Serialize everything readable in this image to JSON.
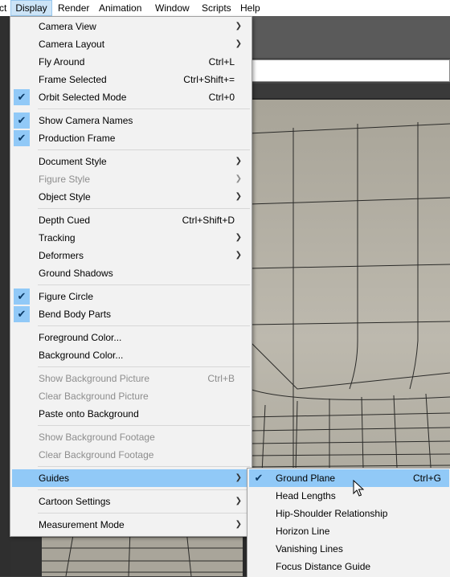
{
  "menubar": {
    "items": [
      "ct",
      "Display",
      "Render",
      "Animation",
      "Window",
      "Scripts",
      "Help"
    ],
    "open_item": "Display"
  },
  "display_menu": {
    "items": [
      {
        "label": "Camera View",
        "submenu": true
      },
      {
        "label": "Camera Layout",
        "submenu": true
      },
      {
        "label": "Fly Around",
        "shortcut": "Ctrl+L"
      },
      {
        "label": "Frame Selected",
        "shortcut": "Ctrl+Shift+="
      },
      {
        "label": "Orbit Selected Mode",
        "shortcut": "Ctrl+0",
        "checked": true
      },
      {
        "label": "Show Camera Names",
        "checked": true
      },
      {
        "label": "Production Frame",
        "checked": true
      },
      {
        "label": "Document Style",
        "submenu": true
      },
      {
        "label": "Figure Style",
        "submenu": true,
        "disabled": true
      },
      {
        "label": "Object Style",
        "submenu": true
      },
      {
        "label": "Depth Cued",
        "shortcut": "Ctrl+Shift+D"
      },
      {
        "label": "Tracking",
        "submenu": true
      },
      {
        "label": "Deformers",
        "submenu": true
      },
      {
        "label": "Ground Shadows"
      },
      {
        "label": "Figure Circle",
        "checked": true
      },
      {
        "label": "Bend Body Parts",
        "checked": true
      },
      {
        "label": "Foreground Color..."
      },
      {
        "label": "Background Color..."
      },
      {
        "label": "Show Background Picture",
        "shortcut": "Ctrl+B",
        "disabled": true
      },
      {
        "label": "Clear Background Picture",
        "disabled": true
      },
      {
        "label": "Paste onto Background"
      },
      {
        "label": "Show Background Footage",
        "disabled": true
      },
      {
        "label": "Clear Background Footage",
        "disabled": true
      },
      {
        "label": "Guides",
        "submenu": true,
        "highlighted": true
      },
      {
        "label": "Cartoon Settings",
        "submenu": true
      },
      {
        "label": "Measurement Mode",
        "submenu": true
      }
    ]
  },
  "guides_menu": {
    "items": [
      {
        "label": "Ground Plane",
        "shortcut": "Ctrl+G",
        "checked": true,
        "highlighted": true
      },
      {
        "label": "Head Lengths"
      },
      {
        "label": "Hip-Shoulder Relationship"
      },
      {
        "label": "Horizon Line"
      },
      {
        "label": "Vanishing Lines"
      },
      {
        "label": "Focus Distance Guide"
      }
    ]
  },
  "icons": {
    "check": "checkmark-icon",
    "submenu": "chevron-right-icon",
    "cursor": "mouse-pointer-icon"
  },
  "colors": {
    "highlight": "#91c9f7",
    "menu_bg": "#f2f2f2",
    "disabled_text": "#8d8d8d",
    "menubar_open": "#cce4f7",
    "viewport": "#b4b0a5"
  }
}
